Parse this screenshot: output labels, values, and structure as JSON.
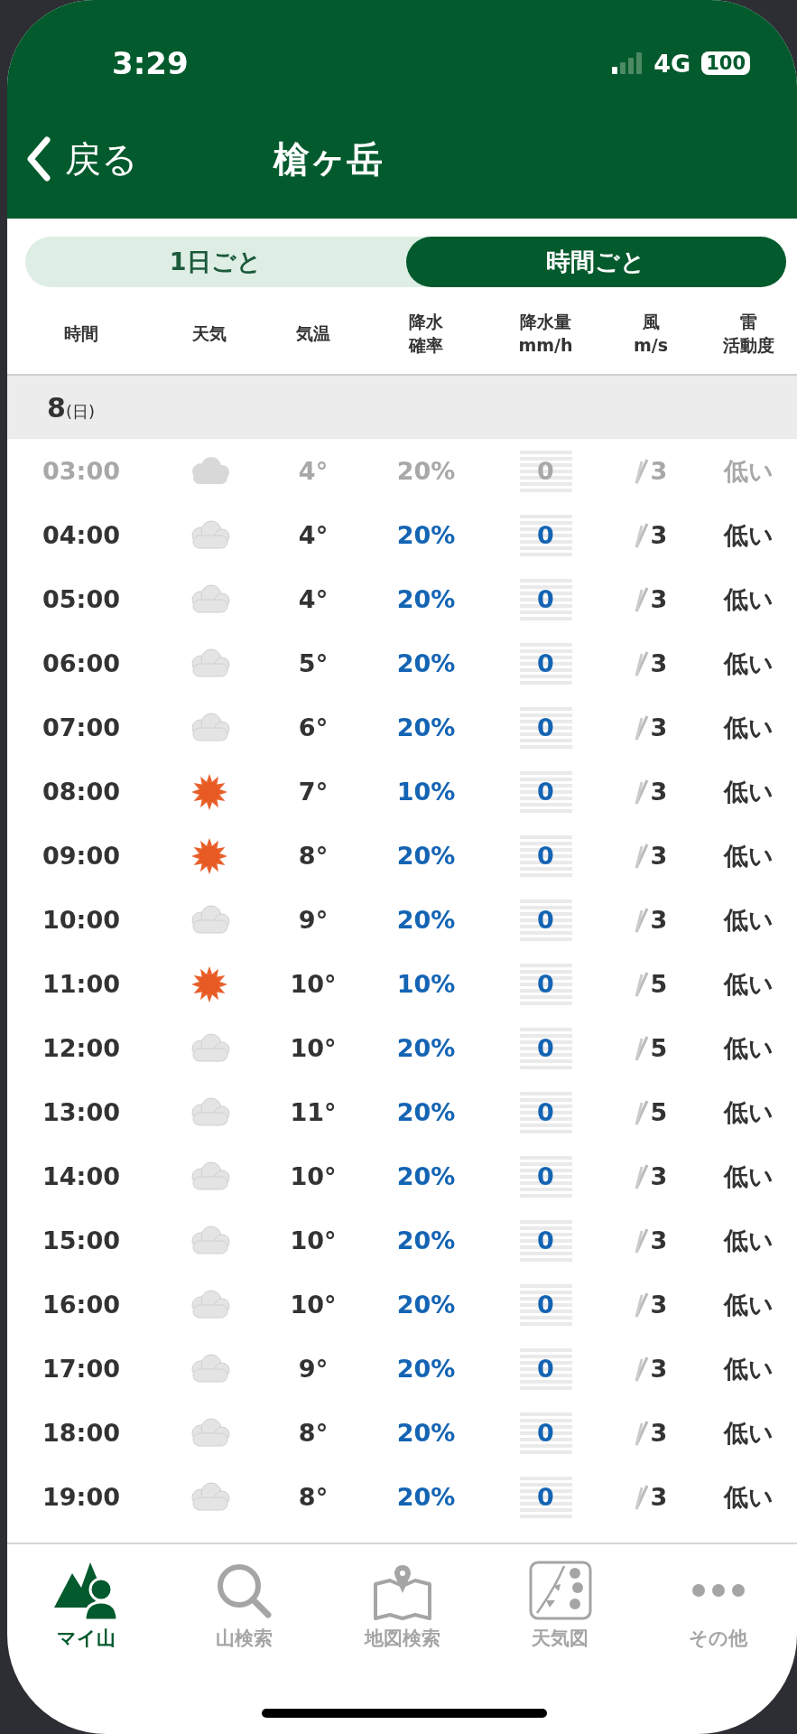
{
  "status_bar": {
    "time": "3:29",
    "network": "4G",
    "battery": "100"
  },
  "nav": {
    "back": "戻る",
    "title": "槍ヶ岳"
  },
  "segments": [
    {
      "label": "1日ごと",
      "selected": false
    },
    {
      "label": "時間ごと",
      "selected": true
    }
  ],
  "columns": [
    [
      "時間"
    ],
    [
      "天気"
    ],
    [
      "気温"
    ],
    [
      "降水",
      "確率"
    ],
    [
      "降水量",
      "mm/h"
    ],
    [
      "風",
      "m/s"
    ],
    [
      "雷",
      "活動度"
    ]
  ],
  "date": {
    "day": "8",
    "weekday": "(日)"
  },
  "rows": [
    {
      "time": "03:00",
      "kind": "cloudy",
      "temp": "4°",
      "prob": "20%",
      "precip": "0",
      "wind": "3",
      "thunder": "低い",
      "past": true
    },
    {
      "time": "04:00",
      "kind": "cloudy",
      "temp": "4°",
      "prob": "20%",
      "precip": "0",
      "wind": "3",
      "thunder": "低い",
      "past": false
    },
    {
      "time": "05:00",
      "kind": "cloudy",
      "temp": "4°",
      "prob": "20%",
      "precip": "0",
      "wind": "3",
      "thunder": "低い",
      "past": false
    },
    {
      "time": "06:00",
      "kind": "cloudy",
      "temp": "5°",
      "prob": "20%",
      "precip": "0",
      "wind": "3",
      "thunder": "低い",
      "past": false
    },
    {
      "time": "07:00",
      "kind": "cloudy",
      "temp": "6°",
      "prob": "20%",
      "precip": "0",
      "wind": "3",
      "thunder": "低い",
      "past": false
    },
    {
      "time": "08:00",
      "kind": "sunny",
      "temp": "7°",
      "prob": "10%",
      "precip": "0",
      "wind": "3",
      "thunder": "低い",
      "past": false
    },
    {
      "time": "09:00",
      "kind": "sunny",
      "temp": "8°",
      "prob": "20%",
      "precip": "0",
      "wind": "3",
      "thunder": "低い",
      "past": false
    },
    {
      "time": "10:00",
      "kind": "cloudy",
      "temp": "9°",
      "prob": "20%",
      "precip": "0",
      "wind": "3",
      "thunder": "低い",
      "past": false
    },
    {
      "time": "11:00",
      "kind": "sunny",
      "temp": "10°",
      "prob": "10%",
      "precip": "0",
      "wind": "5",
      "thunder": "低い",
      "past": false
    },
    {
      "time": "12:00",
      "kind": "cloudy",
      "temp": "10°",
      "prob": "20%",
      "precip": "0",
      "wind": "5",
      "thunder": "低い",
      "past": false
    },
    {
      "time": "13:00",
      "kind": "cloudy",
      "temp": "11°",
      "prob": "20%",
      "precip": "0",
      "wind": "5",
      "thunder": "低い",
      "past": false
    },
    {
      "time": "14:00",
      "kind": "cloudy",
      "temp": "10°",
      "prob": "20%",
      "precip": "0",
      "wind": "3",
      "thunder": "低い",
      "past": false
    },
    {
      "time": "15:00",
      "kind": "cloudy",
      "temp": "10°",
      "prob": "20%",
      "precip": "0",
      "wind": "3",
      "thunder": "低い",
      "past": false
    },
    {
      "time": "16:00",
      "kind": "cloudy",
      "temp": "10°",
      "prob": "20%",
      "precip": "0",
      "wind": "3",
      "thunder": "低い",
      "past": false
    },
    {
      "time": "17:00",
      "kind": "cloudy",
      "temp": "9°",
      "prob": "20%",
      "precip": "0",
      "wind": "3",
      "thunder": "低い",
      "past": false
    },
    {
      "time": "18:00",
      "kind": "cloudy",
      "temp": "8°",
      "prob": "20%",
      "precip": "0",
      "wind": "3",
      "thunder": "低い",
      "past": false
    },
    {
      "time": "19:00",
      "kind": "cloudy",
      "temp": "8°",
      "prob": "20%",
      "precip": "0",
      "wind": "3",
      "thunder": "低い",
      "past": false
    }
  ],
  "tab_bar": [
    {
      "label": "マイ山",
      "kind": "mountain",
      "selected": true
    },
    {
      "label": "山検索",
      "kind": "search",
      "selected": false
    },
    {
      "label": "地図検索",
      "kind": "map",
      "selected": false
    },
    {
      "label": "天気図",
      "kind": "weather_map",
      "selected": false
    },
    {
      "label": "その他",
      "kind": "more",
      "selected": false
    }
  ]
}
